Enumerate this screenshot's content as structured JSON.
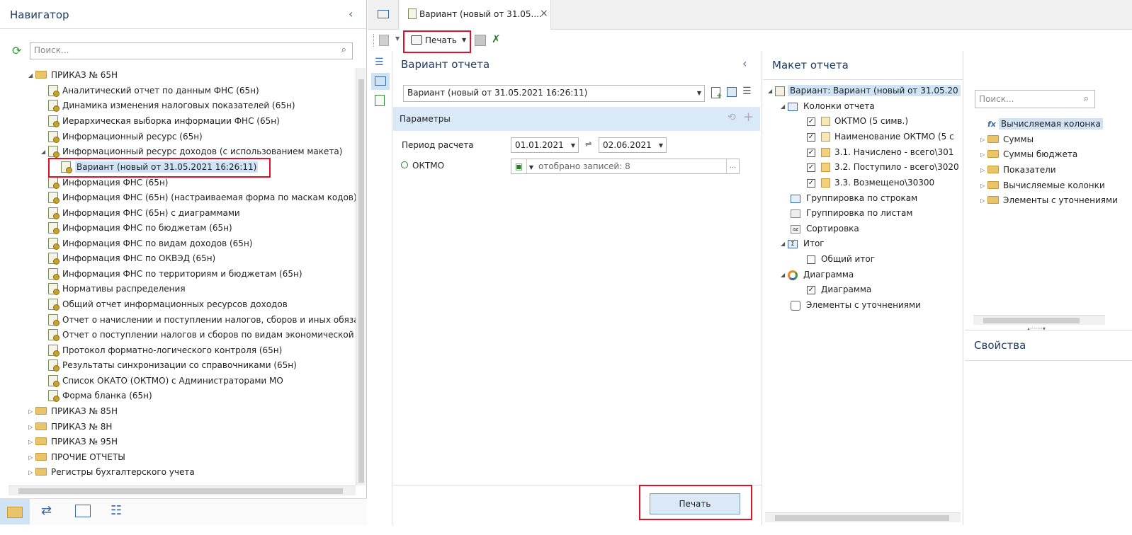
{
  "navigator": {
    "title": "Навигатор",
    "search_placeholder": "Поиск...",
    "root": {
      "label": "ПРИКАЗ № 65Н"
    },
    "items": [
      "Аналитический отчет по данным ФНС (65н)",
      "Динамика изменения налоговых показателей (65н)",
      "Иерархическая выборка информации ФНС (65н)",
      "Информационный ресурс (65н)",
      "Информационный ресурс доходов (с использованием макета)",
      "Вариант (новый от 31.05.2021 16:26:11)",
      "Информация ФНС (65н)",
      "Информация ФНС (65н) (настраиваемая форма по маскам кодов)",
      "Информация ФНС (65н) с диаграммами",
      "Информация ФНС по бюджетам (65н)",
      "Информация ФНС по видам доходов (65н)",
      "Информация ФНС по ОКВЭД (65н)",
      "Информация ФНС по территориям и бюджетам (65н)",
      "Нормативы распределения",
      "Общий отчет информационных ресурсов доходов",
      "Отчет о начислении и поступлении налогов, сборов и иных обязат",
      "Отчет о поступлении налогов и сборов по видам экономической д",
      "Протокол форматно-логического контроля (65н)",
      "Результаты синхронизации со справочниками (65н)",
      "Список ОКАТО (ОКТМО) с Администраторами МО",
      "Форма бланка (65н)"
    ],
    "folders": [
      "ПРИКАЗ № 85Н",
      "ПРИКАЗ № 8Н",
      "ПРИКАЗ № 95Н",
      "ПРОЧИЕ ОТЧЕТЫ",
      "Регистры бухгалтерского учета"
    ]
  },
  "tab": {
    "label": "Вариант (новый от 31.05....",
    "close": "×"
  },
  "toolbar": {
    "print_label": "Печать"
  },
  "variant_panel": {
    "title": "Вариант отчета",
    "variant_value": "Вариант (новый от 31.05.2021 16:26:11)",
    "params_title": "Параметры",
    "period_label": "Период расчета",
    "date_from": "01.01.2021",
    "date_to": "02.06.2021",
    "oktmo_label": "ОКТМО",
    "oktmo_value": "отобрано записей: 8",
    "ellipsis": "...",
    "print_button": "Печать"
  },
  "layout_panel": {
    "title": "Макет отчета",
    "root": "Вариант: Вариант (новый от 31.05.20",
    "columns_label": "Колонки отчета",
    "columns": [
      "ОКТМО (5 симв.)",
      "Наименование ОКТМО (5 с",
      "3.1. Начислено - всего\\301",
      "3.2. Поступило - всего\\3020",
      "3.3. Возмещено\\30300"
    ],
    "group_rows": "Группировка по строкам",
    "group_sheets": "Группировка по листам",
    "sort": "Сортировка",
    "total": "Итог",
    "total_child": "Общий итог",
    "chart": "Диаграмма",
    "chart_child": "Диаграмма",
    "refinements": "Элементы с уточнениями"
  },
  "fields_panel": {
    "search_placeholder": "Поиск...",
    "computed": "Вычисляемая колонка",
    "fx": "fx",
    "items": [
      "Суммы",
      "Суммы бюджета",
      "Показатели",
      "Вычисляемые колонки",
      "Элементы с уточнениями"
    ],
    "properties_title": "Свойства"
  },
  "colors": {
    "accent": "#1f3b63",
    "highlight": "#cfe3f5",
    "red": "#e0102a"
  }
}
